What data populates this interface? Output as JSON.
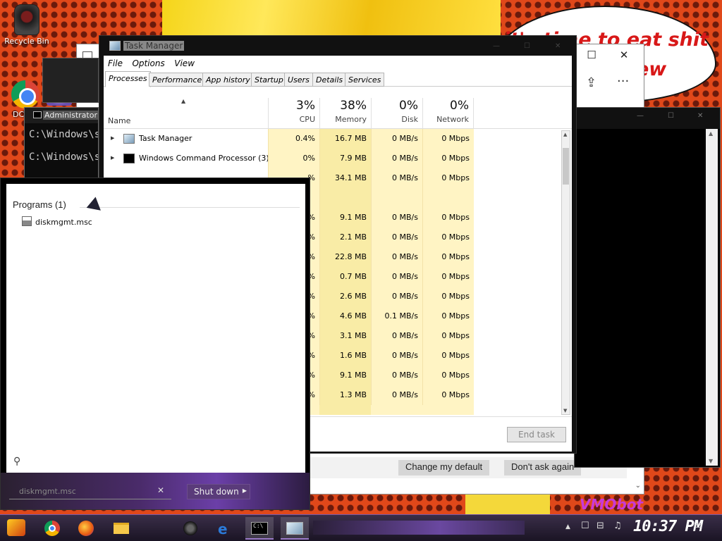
{
  "desktop": {
    "recycle_bin_label": "Recycle Bin",
    "partial_icon_label": "DC",
    "speech_text": "it's time to eat shit\n                    ew",
    "vmobot_text": "VMObot"
  },
  "edge_window": {
    "minimize": "—",
    "maximize": "☐",
    "close": "✕",
    "back_icon": "arrow-left-icon",
    "share_icon": "share-icon",
    "more_label": "···",
    "change_default_label": "Change my default",
    "dont_ask_label": "Don't ask again",
    "infobar_close": "✕"
  },
  "cmd_small": {
    "title": "Administrator",
    "lines": [
      "C:\\Windows\\sy",
      "C:\\Windows\\sy"
    ]
  },
  "task_manager": {
    "title": "Task Manager",
    "menu": [
      "File",
      "Options",
      "View"
    ],
    "tabs": [
      "Processes",
      "Performance",
      "App history",
      "Startup",
      "Users",
      "Details",
      "Services"
    ],
    "active_tab": "Processes",
    "columns": {
      "name": "Name",
      "cpu": {
        "pct": "3%",
        "label": "CPU"
      },
      "memory": {
        "pct": "38%",
        "label": "Memory"
      },
      "disk": {
        "pct": "0%",
        "label": "Disk"
      },
      "network": {
        "pct": "0%",
        "label": "Network"
      }
    },
    "rows": [
      {
        "name": "Task Manager",
        "icon": "task-manager-icon",
        "expandable": true,
        "cpu": "0.4%",
        "memory": "16.7 MB",
        "disk": "0 MB/s",
        "network": "0 Mbps"
      },
      {
        "name": "Windows Command Processor (3)",
        "icon": "cmd-icon",
        "expandable": true,
        "cpu": "0%",
        "memory": "7.9 MB",
        "disk": "0 MB/s",
        "network": "0 Mbps"
      },
      {
        "name": "",
        "cpu": "%",
        "memory": "34.1 MB",
        "disk": "0 MB/s",
        "network": "0 Mbps"
      },
      {
        "name": "",
        "cpu": "",
        "memory": "",
        "disk": "",
        "network": ""
      },
      {
        "name": "",
        "cpu": "%",
        "memory": "9.1 MB",
        "disk": "0 MB/s",
        "network": "0 Mbps"
      },
      {
        "name": "",
        "cpu": "%",
        "memory": "2.1 MB",
        "disk": "0 MB/s",
        "network": "0 Mbps"
      },
      {
        "name": "",
        "cpu": "%",
        "memory": "22.8 MB",
        "disk": "0 MB/s",
        "network": "0 Mbps"
      },
      {
        "name": "",
        "cpu": "%",
        "memory": "0.7 MB",
        "disk": "0 MB/s",
        "network": "0 Mbps"
      },
      {
        "name": "",
        "cpu": "%",
        "memory": "2.6 MB",
        "disk": "0 MB/s",
        "network": "0 Mbps"
      },
      {
        "name": "",
        "cpu": "%",
        "memory": "4.6 MB",
        "disk": "0.1 MB/s",
        "network": "0 Mbps"
      },
      {
        "name": "",
        "cpu": "%",
        "memory": "3.1 MB",
        "disk": "0 MB/s",
        "network": "0 Mbps"
      },
      {
        "name": "",
        "cpu": "%",
        "memory": "1.6 MB",
        "disk": "0 MB/s",
        "network": "0 Mbps"
      },
      {
        "name": "",
        "cpu": "%",
        "memory": "9.1 MB",
        "disk": "0 MB/s",
        "network": "0 Mbps"
      },
      {
        "name": "",
        "cpu": "%",
        "memory": "1.3 MB",
        "disk": "0 MB/s",
        "network": "0 Mbps"
      }
    ],
    "end_task_label": "End task"
  },
  "start_menu": {
    "programs_heading": "Programs (1)",
    "program_result": "diskmgmt.msc",
    "search_value": "diskmgmt.msc",
    "shutdown_label": "Shut down"
  },
  "taskbar": {
    "pinned": [
      "start",
      "chrome",
      "firefox",
      "media-player",
      "file-explorer",
      "steam",
      "edge",
      "cmd",
      "task-manager"
    ],
    "clock": "10:37 PM"
  }
}
